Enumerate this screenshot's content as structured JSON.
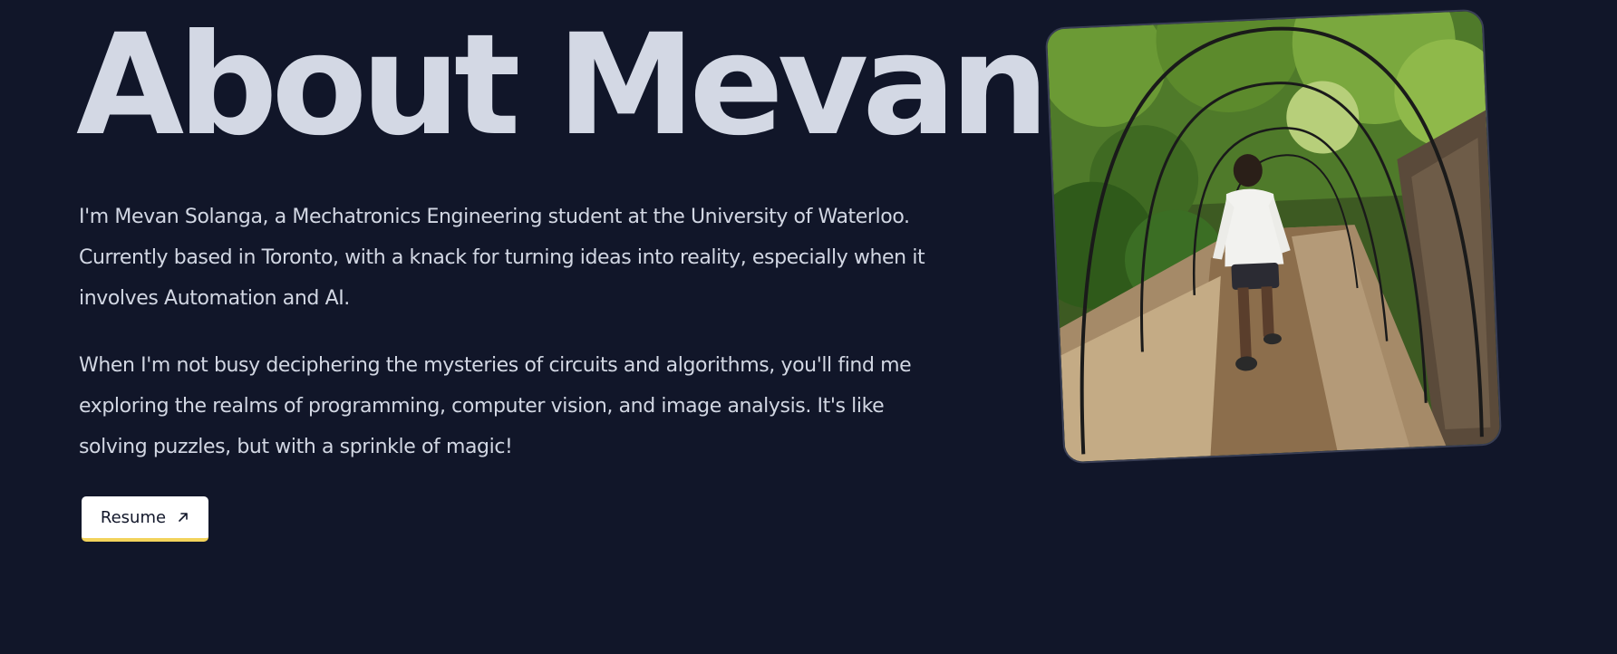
{
  "about": {
    "title": "About Mevan",
    "paragraphs": [
      "I'm Mevan Solanga, a Mechatronics Engineering student at the University of Waterloo. Currently based in Toronto, with a knack for turning ideas into reality, especially when it involves Automation and AI.",
      "When I'm not busy deciphering the mysteries of circuits and algorithms, you'll find me exploring the realms of programming, computer vision, and image analysis. It's like solving puzzles, but with a sprinkle of magic!"
    ],
    "resume_label": "Resume",
    "resume_icon": "arrow-up-right-icon"
  },
  "colors": {
    "background": "#111629",
    "text": "#d2d7e3",
    "button_accent": "#f2d35c"
  },
  "photo": {
    "subject": "portrait-photo"
  }
}
